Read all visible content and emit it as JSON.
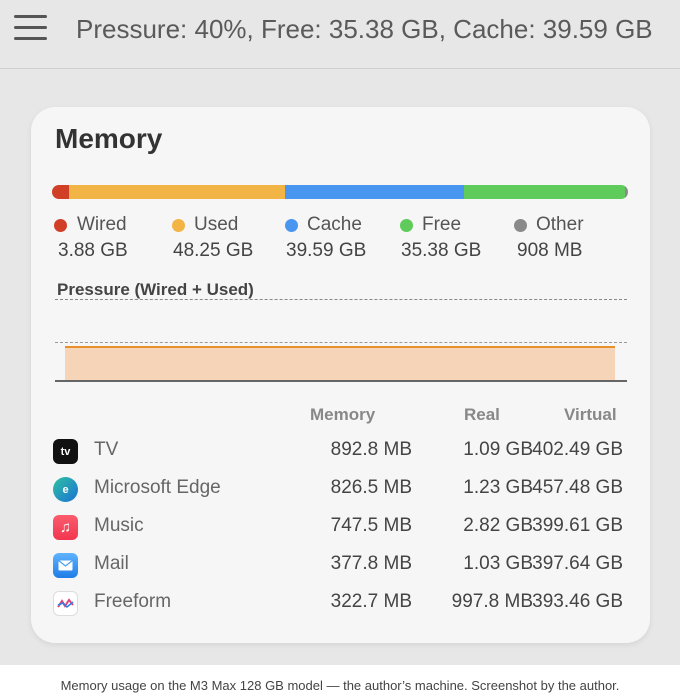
{
  "header": {
    "status": "Pressure: 40%, Free: 35.38 GB, Cache: 39.59 GB",
    "menu_icon": "hamburger-icon"
  },
  "memory": {
    "title": "Memory",
    "bar": [
      {
        "name": "Wired",
        "fraction": 0.03,
        "color": "#d13f27"
      },
      {
        "name": "Used",
        "fraction": 0.375,
        "color": "#f2b445"
      },
      {
        "name": "Cache",
        "fraction": 0.31,
        "color": "#4896f0"
      },
      {
        "name": "Free",
        "fraction": 0.28,
        "color": "#5ecb5a"
      },
      {
        "name": "Other",
        "fraction": 0.005,
        "color": "#8a8a8a"
      }
    ],
    "legend": [
      {
        "label": "Wired",
        "value": "3.88 GB",
        "color": "#d13f27"
      },
      {
        "label": "Used",
        "value": "48.25 GB",
        "color": "#f2b445"
      },
      {
        "label": "Cache",
        "value": "39.59 GB",
        "color": "#4896f0"
      },
      {
        "label": "Free",
        "value": "35.38 GB",
        "color": "#5ecb5a"
      },
      {
        "label": "Other",
        "value": "908 MB",
        "color": "#8a8a8a"
      }
    ],
    "pressure_title": "Pressure (Wired + Used)",
    "pressure_level": 0.4
  },
  "table": {
    "headers": {
      "memory": "Memory",
      "real": "Real",
      "virtual": "Virtual"
    },
    "rows": [
      {
        "icon": "apple-tv-icon",
        "name": "TV",
        "memory": "892.8 MB",
        "real": "1.09 GB",
        "virtual": "402.49 GB"
      },
      {
        "icon": "microsoft-edge-icon",
        "name": "Microsoft Edge",
        "memory": "826.5 MB",
        "real": "1.23 GB",
        "virtual": "457.48 GB"
      },
      {
        "icon": "music-icon",
        "name": "Music",
        "memory": "747.5 MB",
        "real": "2.82 GB",
        "virtual": "399.61 GB"
      },
      {
        "icon": "mail-icon",
        "name": "Mail",
        "memory": "377.8 MB",
        "real": "1.03 GB",
        "virtual": "397.64 GB"
      },
      {
        "icon": "freeform-icon",
        "name": "Freeform",
        "memory": "322.7 MB",
        "real": "997.8 MB",
        "virtual": "393.46 GB"
      }
    ]
  },
  "caption": "Memory usage on the M3 Max 128 GB model — the author’s machine. Screenshot by the author."
}
